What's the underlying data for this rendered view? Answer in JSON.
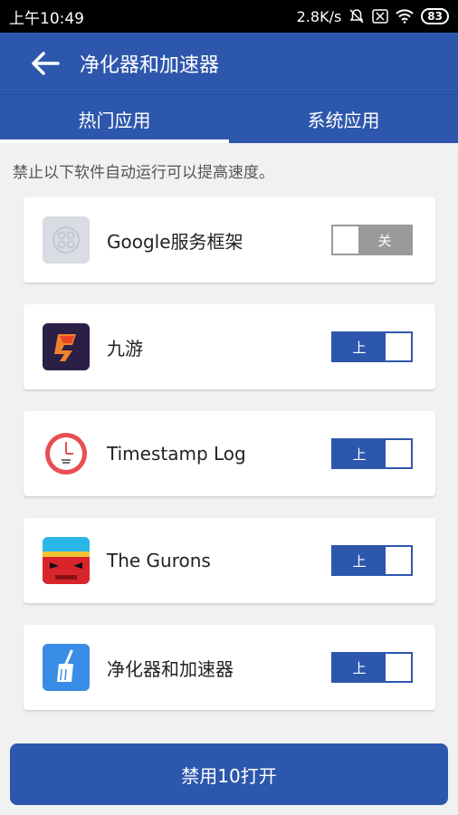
{
  "status_bar": {
    "time": "上午10:49",
    "network_speed": "2.8K/s",
    "battery": "83"
  },
  "header": {
    "title": "净化器和加速器",
    "back_icon": "arrow-left-icon"
  },
  "tabs": [
    {
      "label": "热门应用",
      "active": true
    },
    {
      "label": "系统应用",
      "active": false
    }
  ],
  "hint": "禁止以下软件自动运行可以提高速度。",
  "apps": [
    {
      "name": "Google服务框架",
      "icon": "google-services-icon",
      "toggle_label": "关",
      "enabled": false
    },
    {
      "name": "九游",
      "icon": "jiuyou-icon",
      "toggle_label": "上",
      "enabled": true
    },
    {
      "name": "Timestamp Log",
      "icon": "clock-icon",
      "toggle_label": "上",
      "enabled": true
    },
    {
      "name": "The Gurons",
      "icon": "gurons-icon",
      "toggle_label": "上",
      "enabled": true
    },
    {
      "name": "净化器和加速器",
      "icon": "cleaner-broom-icon",
      "toggle_label": "上",
      "enabled": true
    }
  ],
  "footer": {
    "disable_button": "禁用10打开"
  },
  "colors": {
    "primary": "#2d57ad",
    "toggle_off": "#9a9a9a"
  }
}
